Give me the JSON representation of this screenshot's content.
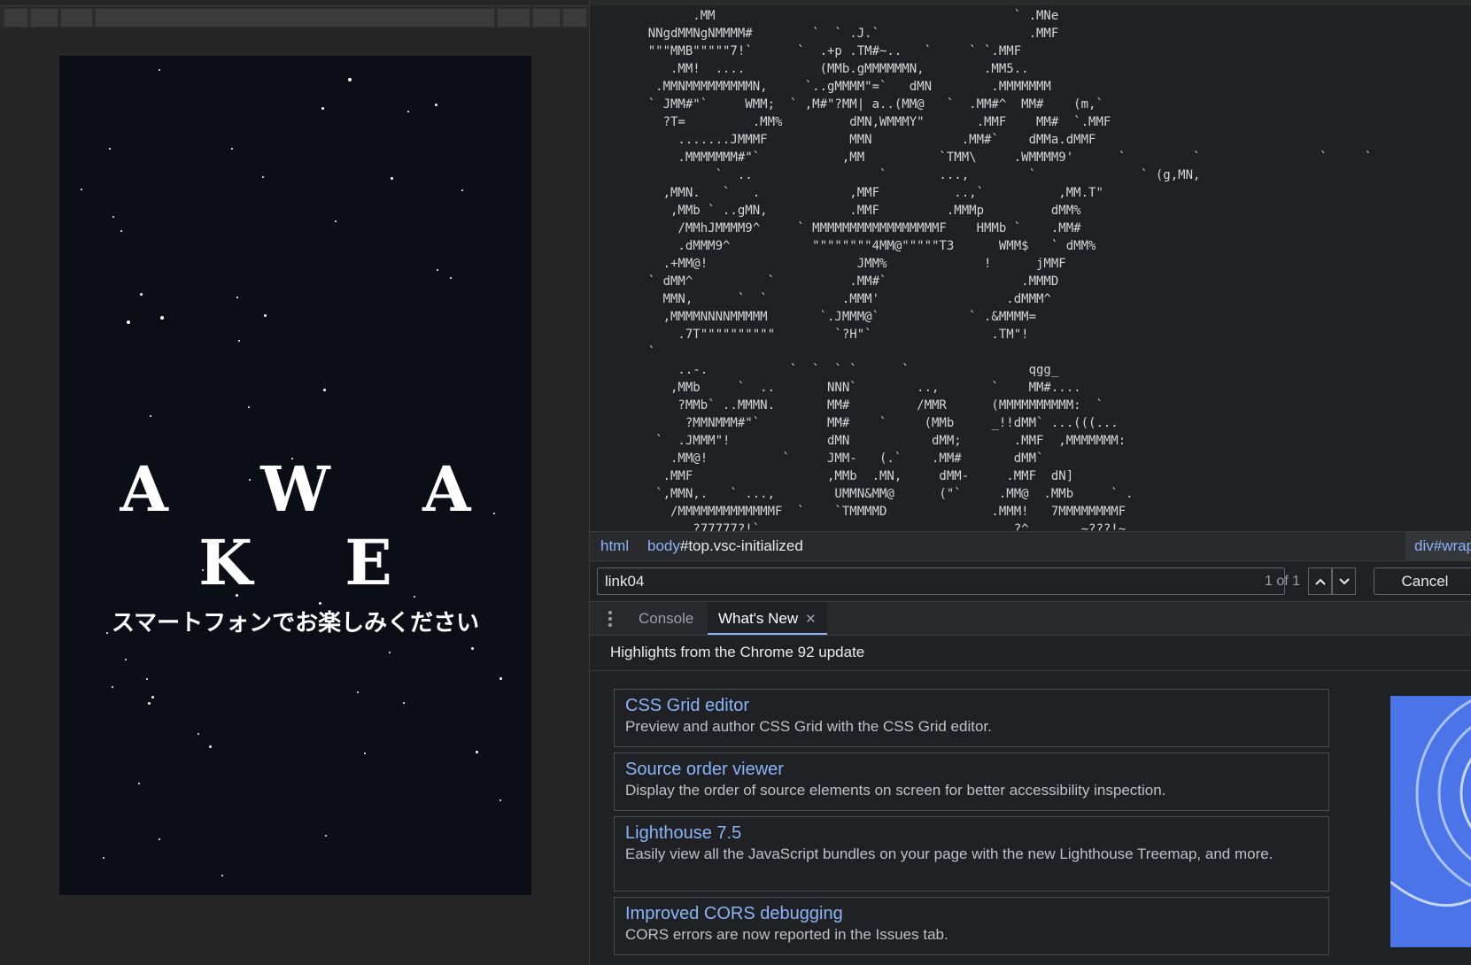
{
  "preview": {
    "title": "A W A K E",
    "subtitle": "スマートフォンでお楽しみください"
  },
  "source_view": {
    "ascii_lines": [
      "          .MM                                        ` .MNe",
      "    NNgdMMNgNMMMM#        `  ` .J.`                    .MMF",
      "    \"\"\"MMB\"\"\"\"\"7!`      `  .+p .TM#~..   `     ` `.MMF",
      "       .MM!  ....          (MMb.gMMMMMMN,        .MM5..",
      "     .MMNMMMMMMMMMN,     `..gMMMM\"=`   dMN        .MMMMMMM",
      "    ` JMM#\"`     WMM;  ` ,M#\"?MM| a..(MM@   `  .MM#^  MM#    (m,`",
      "      ?T=         .MM%         dMN,WMMMY\"       .MMF    MM#  `.MMF",
      "        .......JMMMF           MMN            .MM#`    dMMa.dMMF",
      "        .MMMMMMM#\"`           ,MM          `TMM\\     .WMMMM9'      `         `                `     `",
      "             `  ..                 `       ...,        `              ` (g,MN,",
      "      ,MMN.   `   .            ,MMF          ..,`          ,MM.T\"",
      "       ,MMb ` ..gMN,           .MMF         .MMMp         dMM%",
      "        /MMhJMMMM9^     ` MMMMMMMMMMMMMMMMMF    HMMb `    .MM#",
      "        .dMMM9^           \"\"\"\"\"\"\"\"4MM@\"\"\"\"\"T3      WMM$   ` dMM%",
      "      .+MM@!                    JMM%             !      jMMF",
      "    ` dMM^          `          .MM#`                  .MMMD",
      "      MMN,      `  `          .MMM'                 .dMMM^",
      "      ,MMMMNNNNMMMMM       `.JMMM@`            ` .&MMMM=",
      "        .7T\"\"\"\"\"\"\"\"\"\"        `?H\"`                .TM\"!",
      "    `",
      "        ..-.           `  `  ` `      `                qgg_",
      "       ,MMb     `  ..       NNN`        ..,       `    MM#....",
      "        ?MMb` ..MMMN.       MM#         /MMR      (MMMMMMMMMM:  `",
      "         ?MMNMMM#\"`         MM#    `     (MMb     _!!dMM` ...(((...",
      "     `  .JMMM\"!             dMN           dMM;       .MMF  ,MMMMMMM:",
      "       .MM@!          `     JMM-   (.`    .MM#       dMM`",
      "      .MMF                  ,MMb  .MN,     dMM-     .MMF  dN]",
      "     `,MMN,.   ` ...,        UMMN&MM@      (\"`     .MM@  .MMb     ` .",
      "       /MMMMMMMMMMMMMF  `    `TMMMMD              .MMM!   7MMMMMMMMF",
      "          ?77777?!`                                  ?^       ~???!~"
    ]
  },
  "breadcrumb": [
    {
      "tag": "html",
      "rest": ""
    },
    {
      "tag": "body",
      "rest": "#top.vsc-initialized"
    },
    {
      "tag": "div",
      "rest": "#wrapper"
    }
  ],
  "search": {
    "value": "link04",
    "count": "1 of 1",
    "cancel_label": "Cancel"
  },
  "drawer": {
    "tabs": [
      {
        "label": "Console",
        "active": false
      },
      {
        "label": "What's New",
        "active": true,
        "closable": true
      }
    ],
    "highlights": "Highlights from the Chrome 92 update"
  },
  "features": [
    {
      "title": "CSS Grid editor",
      "desc": "Preview and author CSS Grid with the CSS Grid editor."
    },
    {
      "title": "Source order viewer",
      "desc": "Display the order of source elements on screen for better accessibility inspection."
    },
    {
      "title": "Lighthouse 7.5",
      "desc": "Easily view all the JavaScript bundles on your page with the new Lighthouse Treemap, and more."
    },
    {
      "title": "Improved CORS debugging",
      "desc": "CORS errors are now reported in the Issues tab."
    }
  ],
  "colors": {
    "page_bg": "#0b0d17",
    "devtools_bg": "#202124",
    "link_blue": "#8ab4f8",
    "promo_blue": "#4a74e8"
  },
  "icons": {
    "nav_up": "chevron-up-icon",
    "nav_down": "chevron-down-icon",
    "drawer_menu": "kebab-menu-icon",
    "close_tab": "close-icon"
  }
}
